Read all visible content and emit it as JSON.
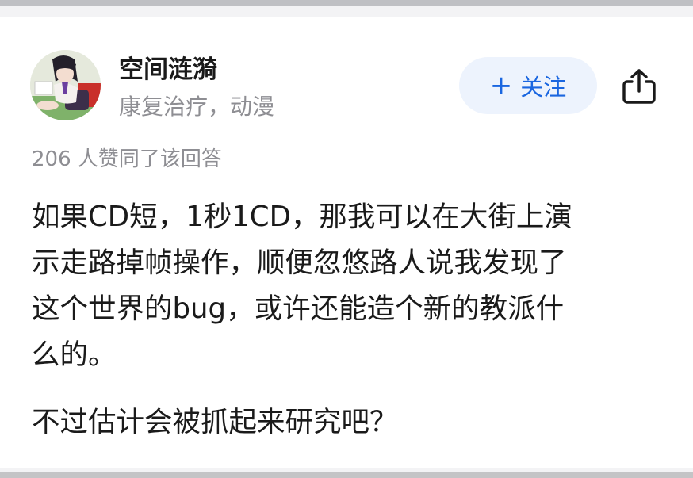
{
  "author": {
    "name": "空间涟漪",
    "bio": "康复治疗，动漫"
  },
  "actions": {
    "follow_plus": "+",
    "follow_label": "关注",
    "share_icon": "share-icon"
  },
  "answer": {
    "vote_summary": "206 人赞同了该回答",
    "paragraphs": [
      {
        "lines": [
          "如果CD短，1秒1CD，那我可以在大街上演",
          "示走路掉帧操作，顺便忽悠路人说我发现了",
          "这个世界的bug，或许还能造个新的教派什",
          "么的。"
        ]
      },
      {
        "lines": [
          "不过估计会被抓起来研究吧？"
        ]
      }
    ]
  },
  "colors": {
    "accent": "#1a66e0",
    "follow_bg": "#edf3fd",
    "muted_text": "#8e8e93",
    "body_text": "#1a1a1a"
  }
}
